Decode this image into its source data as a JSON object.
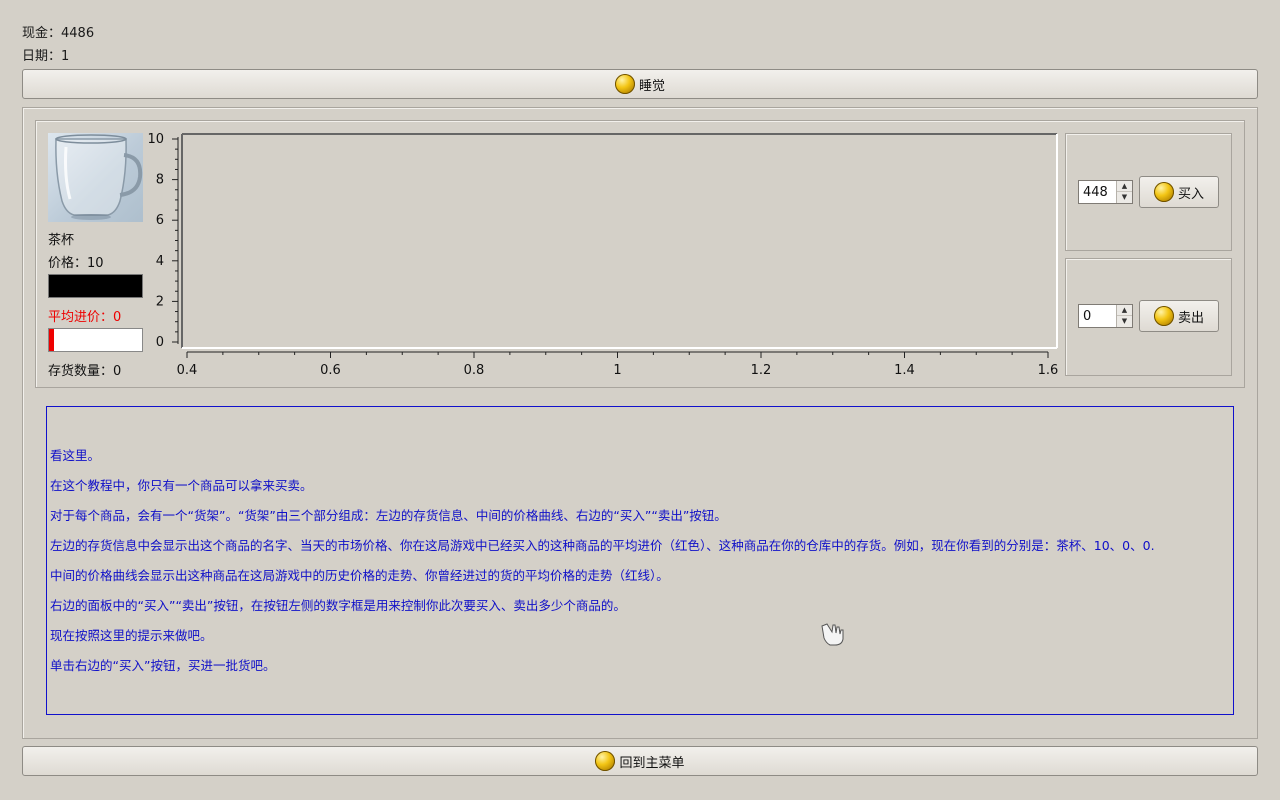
{
  "status": {
    "cash_label": "现金：4486",
    "date_label": "日期：1"
  },
  "sleep_button": {
    "label": "睡觉",
    "icon": "gold-coin-icon"
  },
  "product": {
    "name": "茶杯",
    "price_label": "价格：10",
    "avg_price_label": "平均进价：0",
    "stock_label": "存货数量：0",
    "price_bar_level": 1.0,
    "avg_bar_level": 0.05,
    "colors": {
      "avg_price": "#ee0000",
      "price_bar": "#000000"
    }
  },
  "chart_data": {
    "type": "line",
    "title": "",
    "xlabel": "",
    "ylabel": "",
    "xlim": [
      0.4,
      1.6
    ],
    "ylim": [
      0,
      10
    ],
    "x_ticks": [
      "0.4",
      "0.6",
      "0.8",
      "1",
      "1.2",
      "1.4",
      "1.6"
    ],
    "y_ticks": [
      "0",
      "2",
      "4",
      "6",
      "8",
      "10"
    ],
    "series": []
  },
  "buy": {
    "quantity": "448",
    "label": "买入",
    "icon": "gold-coin-icon"
  },
  "sell": {
    "quantity": "0",
    "label": "卖出",
    "icon": "gold-coin-icon"
  },
  "tutorial": {
    "lines": [
      "看这里。",
      "在这个教程中，你只有一个商品可以拿来买卖。",
      "对于每个商品，会有一个“货架”。“货架”由三个部分组成：左边的存货信息、中间的价格曲线、右边的“买入”“卖出”按钮。",
      "左边的存货信息中会显示出这个商品的名字、当天的市场价格、你在这局游戏中已经买入的这种商品的平均进价（红色）、这种商品在你的仓库中的存货。例如，现在你看到的分别是：茶杯、10、0、0.",
      "中间的价格曲线会显示出这种商品在这局游戏中的历史价格的走势、你曾经进过的货的平均价格的走势（红线）。",
      "右边的面板中的“买入”“卖出”按钮，在按钮左侧的数字框是用来控制你此次要买入、卖出多少个商品的。",
      "现在按照这里的提示来做吧。",
      "单击右边的“买入”按钮，买进一批货吧。"
    ]
  },
  "menu_button": {
    "label": "回到主菜单",
    "icon": "gold-coin-icon"
  }
}
